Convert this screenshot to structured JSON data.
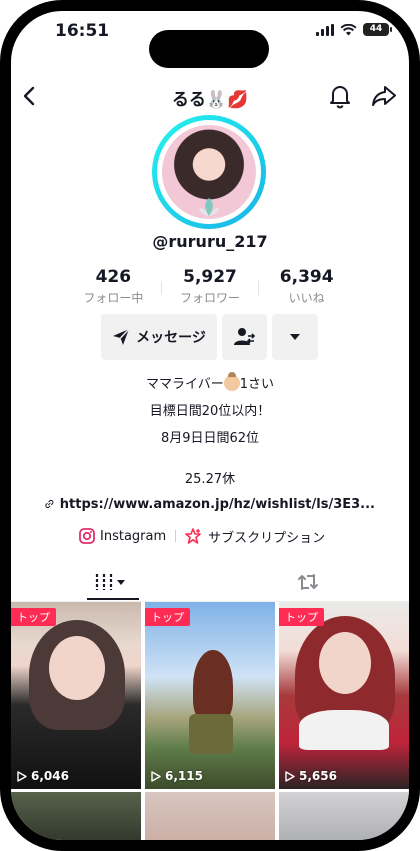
{
  "status": {
    "time": "16:51",
    "battery": "44"
  },
  "header": {
    "title": "るる🐰💋"
  },
  "profile": {
    "username": "@rururu_217"
  },
  "stats": [
    {
      "value": "426",
      "label": "フォロー中"
    },
    {
      "value": "5,927",
      "label": "フォロワー"
    },
    {
      "value": "6,394",
      "label": "いいね"
    }
  ],
  "actions": {
    "message_label": "メッセージ"
  },
  "bio": {
    "line1_prefix": "ママライバー",
    "line1_suffix": "1さい",
    "line2": "目標日間20位以内！",
    "line3": "8月9日日間62位",
    "count": "25.27休"
  },
  "link": "https://www.amazon.jp/hz/wishlist/ls/3E3...",
  "social": {
    "instagram": "Instagram",
    "subscription": "サブスクリプション"
  },
  "videos": [
    {
      "pinned": "トップ",
      "views": "6,046"
    },
    {
      "pinned": "トップ",
      "views": "6,115"
    },
    {
      "pinned": "トップ",
      "views": "5,656"
    }
  ],
  "colors": {
    "accent": "#fe2c55",
    "ring": "#25f4ee"
  }
}
